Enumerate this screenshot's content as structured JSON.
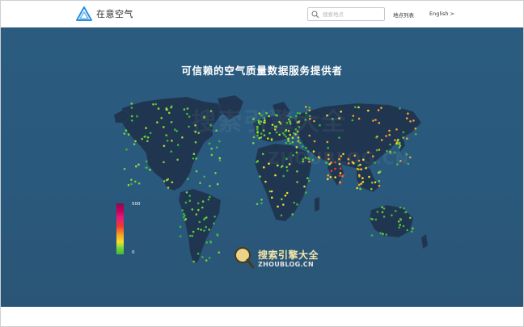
{
  "app": {
    "brand_name": "在意空气",
    "logo_icon": "triangle-logo-icon",
    "accent_color": "#2b8fe0"
  },
  "header": {
    "search": {
      "placeholder": "搜索地点",
      "icon": "search-icon"
    },
    "nav": {
      "stations_label": "地点列表",
      "language_label": "English >"
    }
  },
  "hero": {
    "title": "可信赖的空气质量数据服务提供者",
    "background_color": "#2b5c80",
    "land_color": "#1f3550"
  },
  "legend": {
    "max_label": "500",
    "min_label": "0",
    "colors": [
      "#8a0a4f",
      "#e6197a",
      "#f23a2e",
      "#f7a623",
      "#f2e02c",
      "#76d13d",
      "#3cba3d"
    ]
  },
  "watermark": {
    "cn_text": "搜索引擎大全",
    "en_text": "ZHOUBLOG.CN"
  }
}
